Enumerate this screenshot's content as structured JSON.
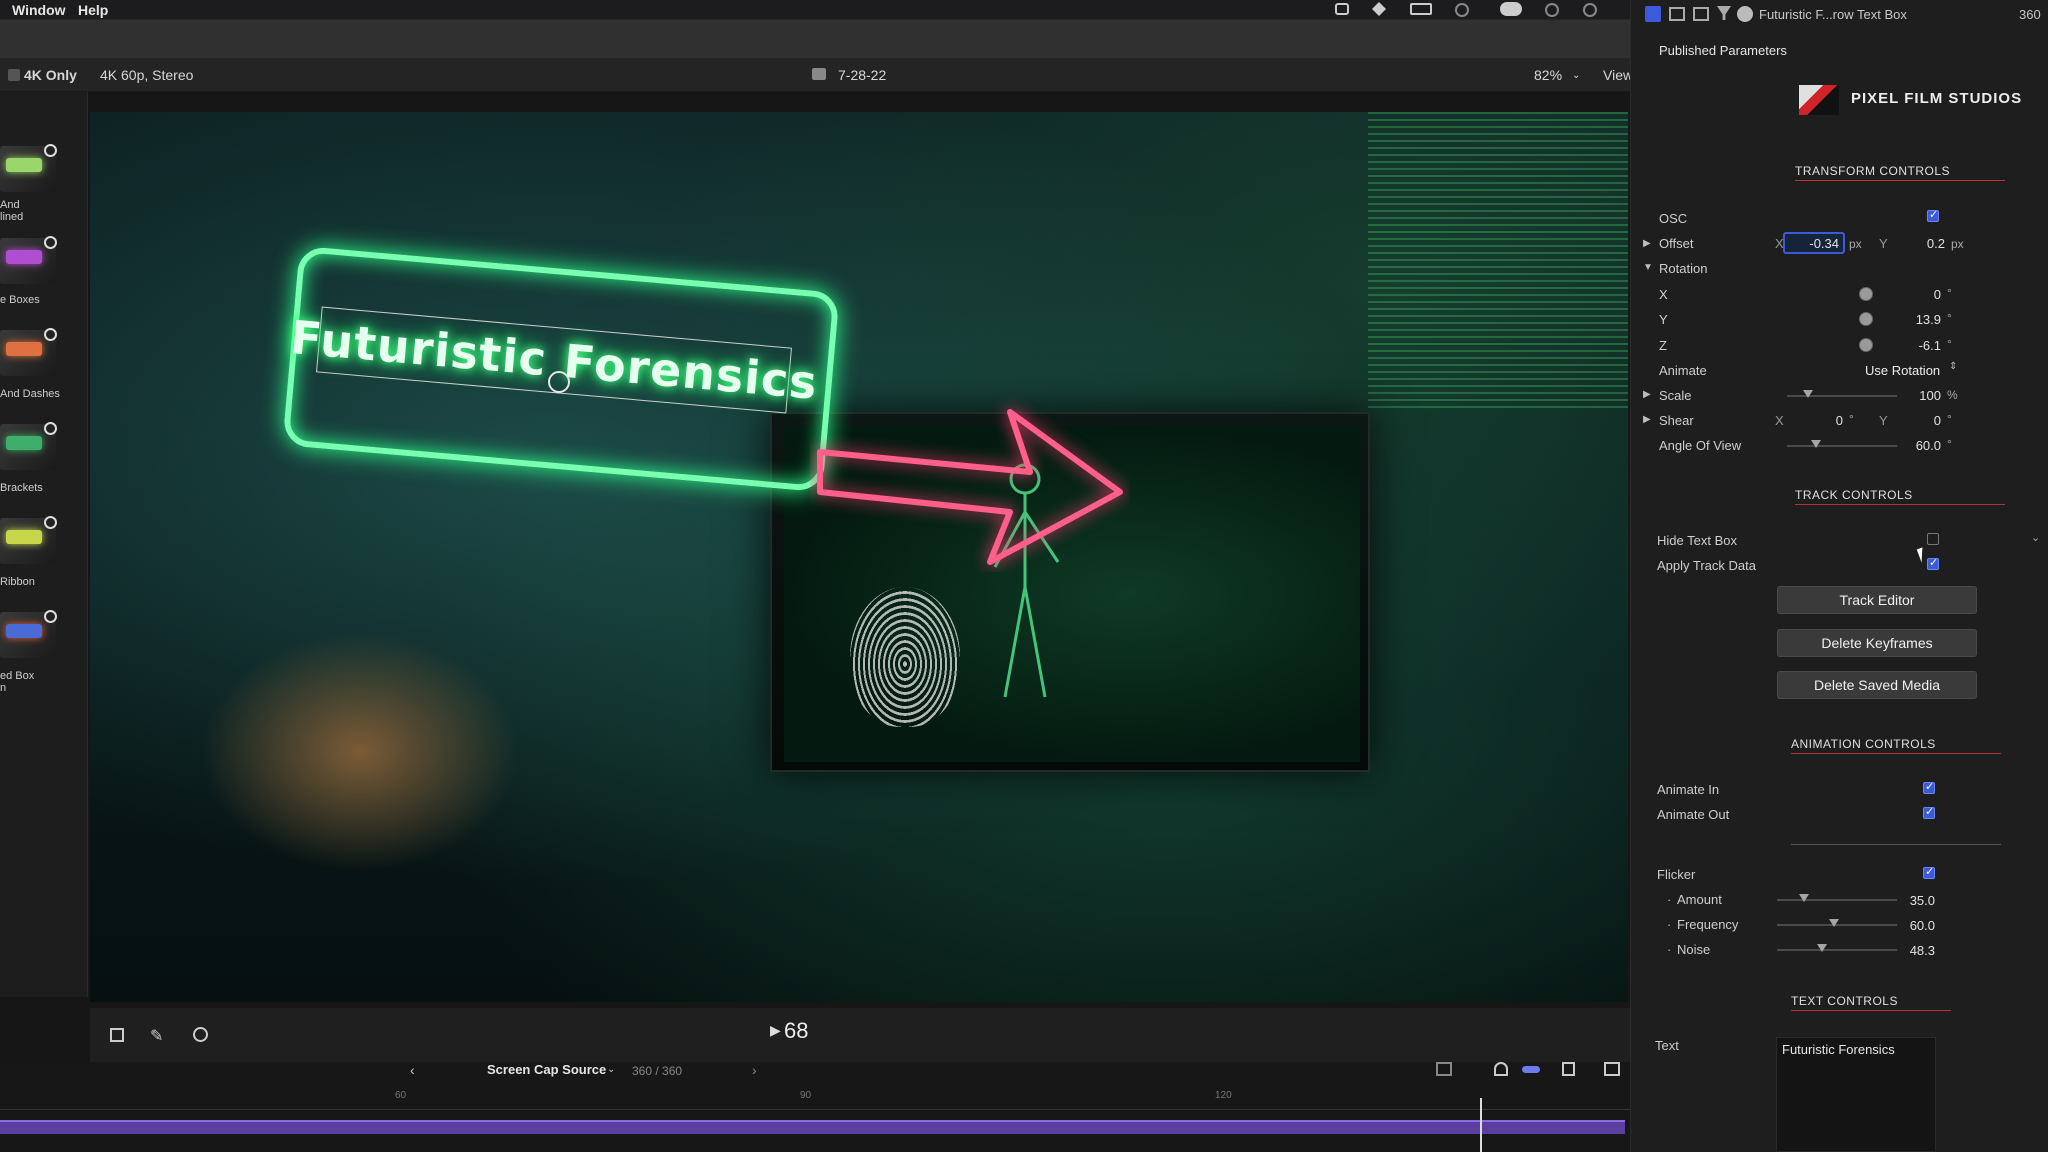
{
  "menubar": {
    "items": [
      "Window",
      "Help"
    ]
  },
  "viewer_bar": {
    "checkbox_label": "4K Only",
    "format": "4K 60p, Stereo",
    "project": "7-28-22",
    "zoom": "82%",
    "view_label": "View"
  },
  "library": {
    "labels": [
      "And\nlined",
      "e Boxes",
      "And Dashes",
      "Brackets",
      "Ribbon",
      "ed Box\nn"
    ]
  },
  "canvas": {
    "title_text": "Futuristic Forensics"
  },
  "transport": {
    "timecode": "68",
    "source_label": "Screen Cap Source",
    "frame_count": "360 / 360",
    "ruler_marks": [
      "60",
      "90",
      "120"
    ]
  },
  "inspector": {
    "header_title": "Futuristic F...row Text Box",
    "header_value": "360",
    "published_params": "Published Parameters",
    "brand_name": "PIXEL FILM STUDIOS",
    "transform": {
      "heading": "TRANSFORM CONTROLS",
      "osc_label": "OSC",
      "offset_label": "Offset",
      "offset_x": "-0.34",
      "offset_y": "0.2",
      "px_unit": "px",
      "rotation_label": "Rotation",
      "rot_x_label": "X",
      "rot_x": "0",
      "rot_y_label": "Y",
      "rot_y": "13.9",
      "rot_z_label": "Z",
      "rot_z": "-6.1",
      "degree": "°",
      "animate_label": "Animate",
      "animate_value": "Use Rotation",
      "scale_label": "Scale",
      "scale_value": "100",
      "percent": "%",
      "shear_label": "Shear",
      "shear_x": "0",
      "shear_y": "0",
      "aov_label": "Angle Of View",
      "aov_value": "60.0",
      "x_letter": "X",
      "y_letter": "Y"
    },
    "track": {
      "heading": "TRACK CONTROLS",
      "hide_label": "Hide Text Box",
      "apply_label": "Apply Track Data",
      "btn_editor": "Track Editor",
      "btn_delete_keys": "Delete Keyframes",
      "btn_delete_media": "Delete Saved Media"
    },
    "animation": {
      "heading": "ANIMATION CONTROLS",
      "in_label": "Animate In",
      "out_label": "Animate Out",
      "flicker_label": "Flicker",
      "amount_label": "Amount",
      "amount_value": "35.0",
      "frequency_label": "Frequency",
      "frequency_value": "60.0",
      "noise_label": "Noise",
      "noise_value": "48.3"
    },
    "text": {
      "heading": "TEXT CONTROLS",
      "text_label": "Text",
      "text_value": "Futuristic Forensics"
    }
  },
  "colors": {
    "neon_green": "#79ffb2",
    "neon_pink": "#ff5f8a",
    "accent_blue": "#3b5bdb",
    "section_red": "#b8323a"
  }
}
